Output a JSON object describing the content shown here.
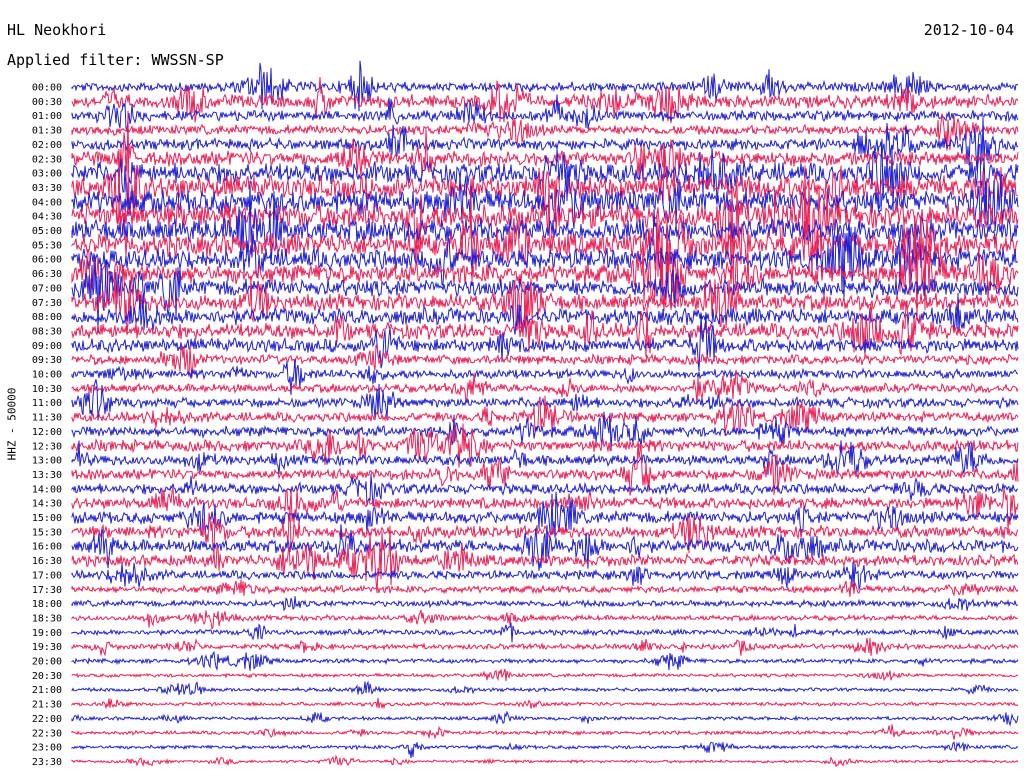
{
  "header": {
    "station": "HL Neokhori",
    "filter": "Applied filter: WWSSN-SP",
    "date": "2012-10-04"
  },
  "colors": {
    "trace_a": "#1f1fd6",
    "trace_b": "#ee1f55",
    "background": "#ffffff",
    "text": "#000000"
  },
  "chart_data": {
    "type": "line",
    "title": "HL Neokhori",
    "subtitle": "Applied filter: WWSSN-SP",
    "date": "2012-10-04",
    "ylabel": "HHZ - 50000",
    "xlabel": "",
    "y_tick_labels": [
      "00:00",
      "00:30",
      "01:00",
      "01:30",
      "02:00",
      "02:30",
      "03:00",
      "03:30",
      "04:00",
      "04:30",
      "05:00",
      "05:30",
      "06:00",
      "06:30",
      "07:00",
      "07:30",
      "08:00",
      "08:30",
      "09:00",
      "09:30",
      "10:00",
      "10:30",
      "11:00",
      "11:30",
      "12:00",
      "12:30",
      "13:00",
      "13:30",
      "14:00",
      "14:30",
      "15:00",
      "15:30",
      "16:00",
      "16:30",
      "17:00",
      "17:30",
      "18:00",
      "18:30",
      "19:00",
      "19:30",
      "20:00",
      "20:30",
      "21:00",
      "21:30",
      "22:00",
      "22:30",
      "23:00",
      "23:30"
    ],
    "trace_colors_alternating": [
      "#1f1fd6",
      "#ee1f55"
    ],
    "relative_noise_amplitude": [
      1.1,
      1.5,
      1.2,
      1.1,
      1.3,
      1.7,
      2.4,
      2.7,
      2.8,
      2.8,
      2.7,
      2.6,
      2.4,
      2.2,
      2.0,
      1.9,
      1.9,
      1.8,
      1.6,
      1.1,
      1.0,
      1.0,
      1.1,
      1.1,
      1.2,
      1.3,
      1.2,
      1.2,
      1.2,
      1.3,
      1.4,
      1.4,
      1.5,
      1.3,
      1.0,
      0.8,
      0.7,
      0.6,
      0.6,
      0.6,
      0.5,
      0.4,
      0.4,
      0.4,
      0.4,
      0.4,
      0.4,
      0.3
    ],
    "grid": false,
    "legend": "none"
  }
}
